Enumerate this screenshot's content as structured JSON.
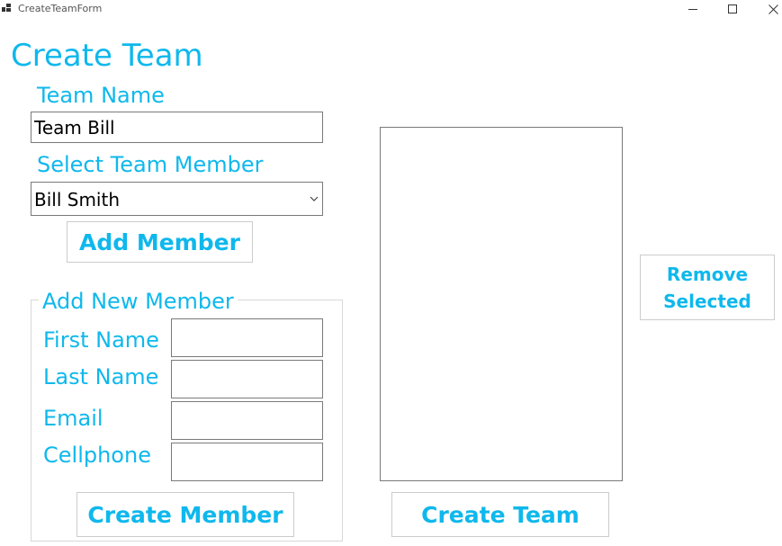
{
  "window": {
    "title": "CreateTeamForm",
    "icon": "app-icon",
    "controls": {
      "minimize": "minimize-icon",
      "maximize": "maximize-icon",
      "close": "close-icon"
    }
  },
  "form": {
    "heading": "Create Team",
    "team_name_label": "Team Name",
    "team_name_value": "Team Bill",
    "select_member_label": "Select Team Member",
    "select_member_value": "Bill Smith",
    "add_member_button": "Add Member"
  },
  "new_member_group": {
    "legend": "Add New Member",
    "first_name_label": "First Name",
    "first_name_value": "",
    "last_name_label": "Last Name",
    "last_name_value": "",
    "email_label": "Email",
    "email_value": "",
    "cellphone_label": "Cellphone",
    "cellphone_value": "",
    "create_member_button": "Create Member"
  },
  "team_members_list": {
    "items": []
  },
  "actions": {
    "remove_selected_line1": "Remove",
    "remove_selected_line2": "Selected",
    "create_team_button": "Create Team"
  },
  "colors": {
    "accent": "#0fb8ec",
    "border": "#7a7a7a",
    "button_border": "#cccccc"
  }
}
